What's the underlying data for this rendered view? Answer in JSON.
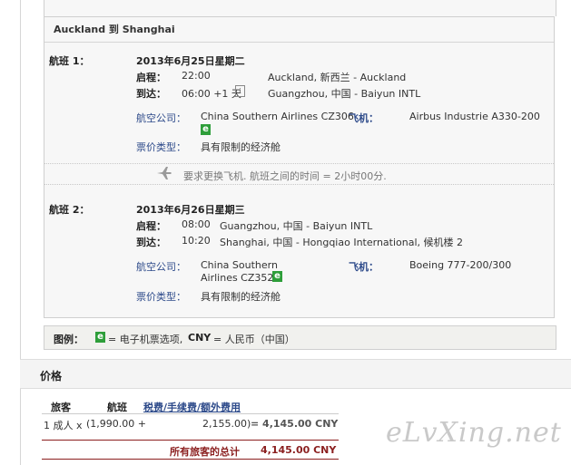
{
  "route_title": "Auckland 到 Shanghai",
  "flights": [
    {
      "label": "航班 1：",
      "date": "2013年6月25日星期二",
      "depart_label": "启程：",
      "depart_time": "22:00",
      "depart_place": "Auckland, 新西兰 - Auckland",
      "arrive_label": "到达：",
      "arrive_time": "06:00 +1 天",
      "arrive_place": "Guangzhou, 中国 - Baiyun INTL",
      "airline_label": "航空公司：",
      "airline": "China Southern Airlines CZ306",
      "aircraft_label": "飞机：",
      "aircraft": "Airbus Industrie A330-200",
      "fare_label": "票价类型：",
      "fare": "具有限制的经济舱"
    },
    {
      "label": "航班 2：",
      "date": "2013年6月26日星期三",
      "depart_label": "启程：",
      "depart_time": "08:00",
      "depart_place": "Guangzhou, 中国 - Baiyun INTL",
      "arrive_label": "到达：",
      "arrive_time": "10:20",
      "arrive_place": "Shanghai, 中国 - Hongqiao International, 候机楼 2",
      "airline_label": "航空公司：",
      "airline_line1": "China Southern",
      "airline_line2": "Airlines CZ3523",
      "aircraft_label": "飞机：",
      "aircraft": "Boeing 777-200/300",
      "fare_label": "票价类型：",
      "fare": "具有限制的经济舱"
    }
  ],
  "connection_note": "要求更换飞机. 航班之间的时间 = 2小时00分.",
  "info_glyph": "i",
  "e_badge": "e",
  "legend": {
    "label": "图例：",
    "e_text": "= 电子机票选项,",
    "cny_code": "CNY",
    "cny_text": "= 人民币（中国）"
  },
  "price": {
    "title": "价格",
    "col_passenger": "旅客",
    "col_flight": "航班",
    "col_fees": "税费/手续费/额外费用",
    "row_passenger": "1 成人 x",
    "row_flight": "(1,990.00  +",
    "row_fees": "2,155.00)",
    "row_total": "= 4,145.00 CNY",
    "total_label": "所有旅客的总计",
    "total_value": "4,145.00 CNY"
  },
  "watermark": "eLvXing.net",
  "colors": {
    "e_badge": "#2e9e3a",
    "link": "#2d4a8a",
    "total_red": "#8b1f1f"
  }
}
